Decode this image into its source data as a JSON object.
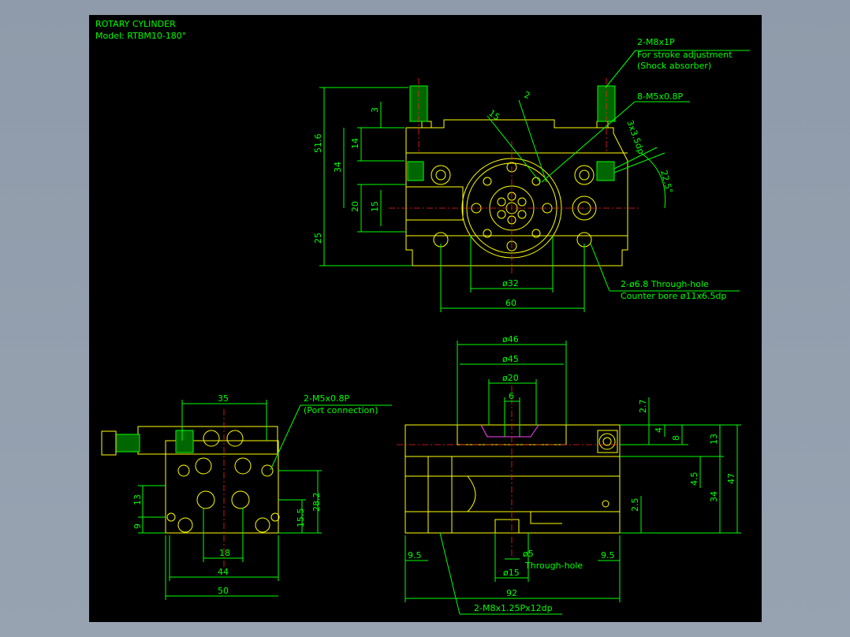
{
  "title": {
    "line1": "ROTARY CYLINDER",
    "line2": "Model: RTBM10-180°"
  },
  "top_view": {
    "callout_stroke_1": "2-M8x1P",
    "callout_stroke_2": "For stroke adjustment",
    "callout_stroke_3": "(Shock absorber)",
    "callout_m5": "8-M5x0.8P",
    "callout_through_1": "2-ø6.8 Through-hole",
    "callout_through_2": "Counter bore ø11x6.5dp",
    "dim_51_6": "51.6",
    "dim_3": "3",
    "dim_14": "14",
    "dim_34": "34",
    "dim_20": "20",
    "dim_15": "15",
    "dim_25": "25",
    "dim_15_angle": "15",
    "dim_2": "2",
    "dim_3x3_5dp": "3x3.5dp",
    "dim_22_5": "22.5°",
    "dim_d32": "ø32",
    "dim_60": "60"
  },
  "left_view": {
    "callout_1": "2-M5x0.8P",
    "callout_2": "(Port connection)",
    "dim_35": "35",
    "dim_13": "13",
    "dim_9": "9",
    "dim_28_2": "28.2",
    "dim_15_5": "15.5",
    "dim_18": "18",
    "dim_44": "44",
    "dim_50": "50"
  },
  "front_view": {
    "dim_d46": "ø46",
    "dim_d45": "ø45",
    "dim_d20": "ø20",
    "dim_6": "6",
    "dim_2_7": "2.7",
    "dim_4": "4",
    "dim_8": "8",
    "dim_13": "13",
    "dim_47": "47",
    "dim_4_5": "4.5",
    "dim_34": "34",
    "dim_2_5": "2.5",
    "dim_9_5_left": "9.5",
    "dim_9_5_right": "9.5",
    "dim_d5": "ø5",
    "dim_through_hole": "Through-hole",
    "dim_d15": "ø15",
    "dim_92": "92",
    "callout_m8": "2-M8x1.25Px12dp"
  },
  "colors": {
    "background": "#000000",
    "dimension": "#00ff00",
    "object": "#ffff00",
    "center_line": "#ff2020",
    "hidden": "#ff8000",
    "highlight": "#ff40ff",
    "frame": "#8e9aa9"
  }
}
